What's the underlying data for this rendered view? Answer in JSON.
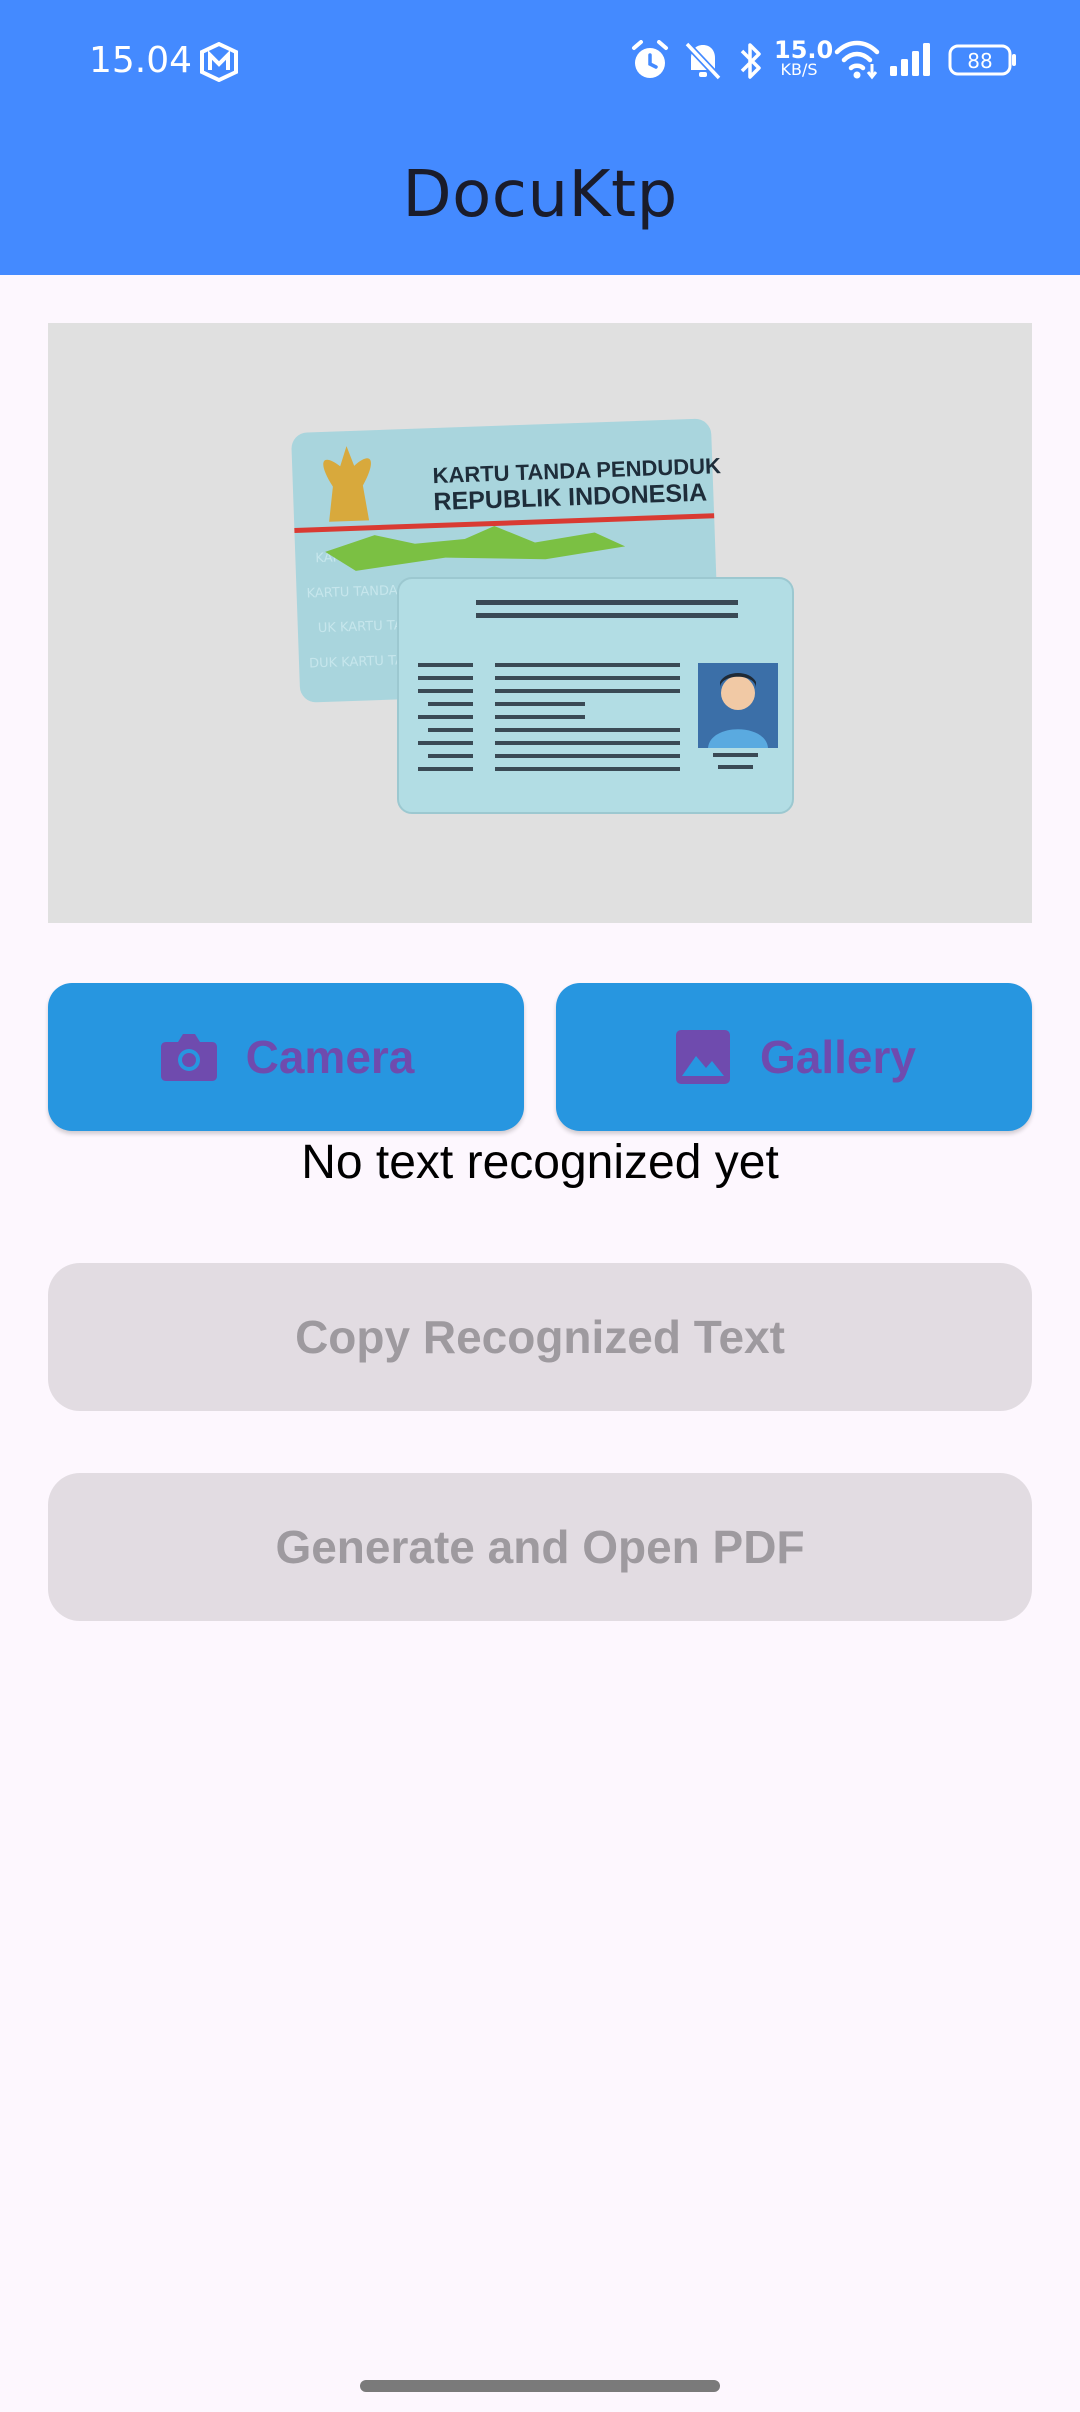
{
  "status_bar": {
    "time": "15.04",
    "network_speed": "15.0",
    "network_unit": "KB/S",
    "battery": "88",
    "icons": [
      "m-app-icon",
      "alarm-icon",
      "bell-off-icon",
      "bluetooth-icon",
      "wifi-icon",
      "signal-icon",
      "battery-icon"
    ]
  },
  "app_bar": {
    "title": "DocuKtp"
  },
  "image_preview": {
    "card_line1": "KARTU TANDA PENDUDUK",
    "card_line2": "REPUBLIK INDONESIA"
  },
  "buttons": {
    "camera": "Camera",
    "gallery": "Gallery",
    "copy": "Copy Recognized Text",
    "pdf": "Generate and Open PDF"
  },
  "result_text": "No text recognized yet",
  "colors": {
    "app_bar": "#448AFF",
    "primary_button": "#2796E0",
    "button_text": "#6F4BAE",
    "disabled_button": "#E2DCE2",
    "disabled_text": "#9E9A9F",
    "background": "#FDF7FE"
  }
}
